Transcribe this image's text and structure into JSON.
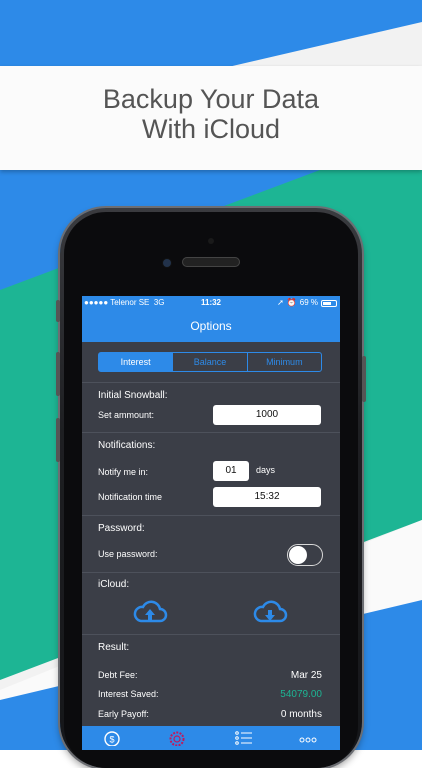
{
  "colors": {
    "accent": "#2d8ae8",
    "green": "#1db594",
    "screen_bg": "#3b3e47"
  },
  "headline": {
    "line1": "Backup Your Data",
    "line2": "With iCloud"
  },
  "status_bar": {
    "carrier": "●●●●● Telenor SE",
    "network": "3G",
    "time": "11:32",
    "battery_text": "69 %",
    "battery_level": 0.69
  },
  "nav": {
    "title": "Options"
  },
  "segments": [
    {
      "label": "Interest",
      "selected": true
    },
    {
      "label": "Balance",
      "selected": false
    },
    {
      "label": "Minimum",
      "selected": false
    }
  ],
  "snowball": {
    "title": "Initial Snowball:",
    "label": "Set ammount:",
    "value": "1000"
  },
  "notifications": {
    "title": "Notifications:",
    "notify_label": "Notify me in:",
    "notify_value": "01",
    "notify_unit": "days",
    "time_label": "Notification time",
    "time_value": "15:32"
  },
  "password": {
    "title": "Password:",
    "use_label": "Use password:",
    "enabled": false
  },
  "icloud": {
    "title": "iCloud:",
    "icons": [
      "cloud-upload-icon",
      "cloud-download-icon"
    ]
  },
  "result": {
    "title": "Result:",
    "debt_fee_label": "Debt Fee:",
    "debt_fee_value": "Mar 25",
    "interest_saved_label": "Interest Saved:",
    "interest_saved_value": "54079.00",
    "early_payoff_label": "Early Payoff:",
    "early_payoff_value": "0 months"
  },
  "tabbar": {
    "icons": [
      "dollar-coin-icon",
      "gear-icon",
      "list-icon",
      "more-icon"
    ],
    "active": "gear-icon"
  }
}
